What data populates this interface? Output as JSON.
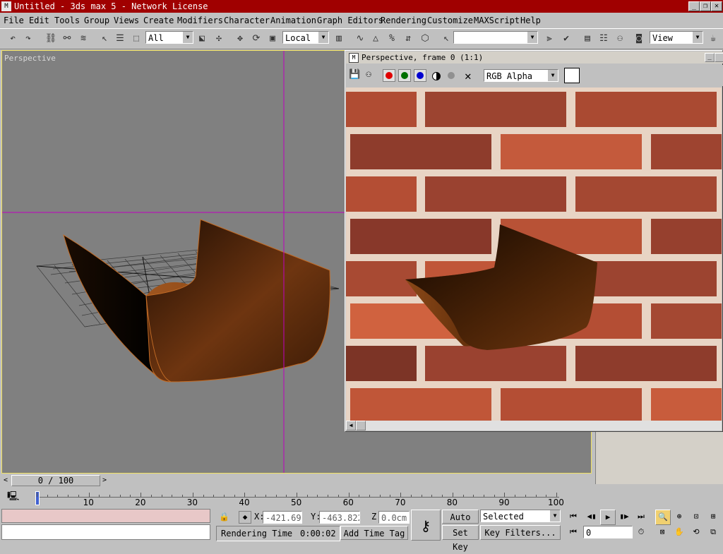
{
  "window": {
    "title": "Untitled - 3ds max 5 - Network License"
  },
  "menu": [
    "File",
    "Edit",
    "Tools",
    "Group",
    "Views",
    "Create",
    "Modifiers",
    "Character",
    "Animation",
    "Graph Editors",
    "Rendering",
    "Customize",
    "MAXScript",
    "Help"
  ],
  "toolbar": {
    "selection_filter": "All",
    "coord_system": "Local",
    "named_selection": "",
    "render_view": "View"
  },
  "viewport": {
    "label": "Perspective"
  },
  "render_frame": {
    "title": "Perspective, frame 0 (1:1)",
    "channel": "RGB Alpha"
  },
  "timeline": {
    "frame_display": "0 / 100",
    "ticks": [
      "0",
      "10",
      "20",
      "30",
      "40",
      "50",
      "60",
      "70",
      "80",
      "90",
      "100"
    ]
  },
  "status": {
    "x_label": "X:",
    "x_value": "-421.696",
    "y_label": "Y:",
    "y_value": "-463.822",
    "z_label": "Z:",
    "z_value": "0.0cm",
    "render_time_label": "Rendering Time",
    "render_time_value": "0:00:02",
    "add_time_tag": "Add Time Tag",
    "auto_key": "Auto Key",
    "set_key": "Set Key",
    "key_mode": "Selected",
    "key_filters": "Key Filters...",
    "current_frame": "0"
  },
  "colors": {
    "titlebar": "#a00000",
    "viewport_bg": "#808080",
    "viewport_border": "#f0e060",
    "crosshair": "#c000c0",
    "mortar": "#e8d4c4"
  }
}
